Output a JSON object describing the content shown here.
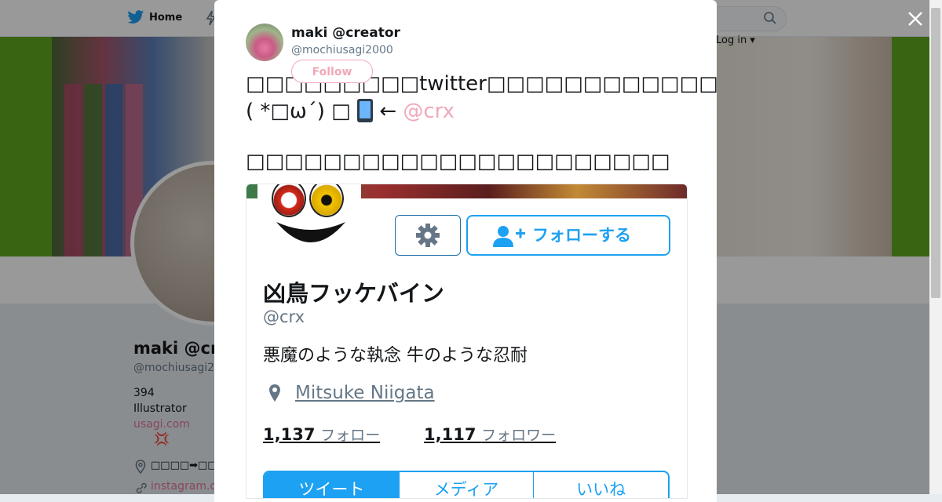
{
  "nav": {
    "home_label": "Home",
    "login_label": "Log in ▾"
  },
  "profile": {
    "name": "maki @cr",
    "handle": "@mochiusagi2",
    "tweet_count": "394",
    "bio": "Illustrator",
    "website": "usagi.com",
    "anger_symbol": "💢",
    "location": "□□□□➡□□□➡",
    "link": "instagram.c"
  },
  "tweet": {
    "author_name": "maki @creator",
    "author_handle": "@mochiusagi2000",
    "follow_label": "Follow",
    "line1": "□□□□□□□□□twitter□□□□□□□□□□□□□",
    "line2_prefix": "( *□ω´) □ ",
    "line2_arrow": "← ",
    "line2_mention": "@crx",
    "line3": "□□□□□□□□□□□□□□□□□□□□□□"
  },
  "embedded_profile": {
    "follow_button": "フォローする",
    "name": "凶鳥フッケバイン",
    "handle": "@crx",
    "bio": "悪魔のような執念 牛のような忍耐",
    "location": "Mitsuke Niigata",
    "following_count": "1,137",
    "following_label": "フォロー",
    "followers_count": "1,117",
    "followers_label": "フォロワー",
    "tabs": [
      "ツイート",
      "メディア",
      "いいね"
    ]
  },
  "colors": {
    "accent": "#1da1f2",
    "pink": "#f0a8b8",
    "banner_green": "#5fa81e"
  },
  "icons": [
    "twitter-bird-icon",
    "lightning-icon",
    "search-icon",
    "close-icon",
    "location-pin-icon",
    "link-icon",
    "phone-icon",
    "gear-icon",
    "add-user-icon"
  ]
}
